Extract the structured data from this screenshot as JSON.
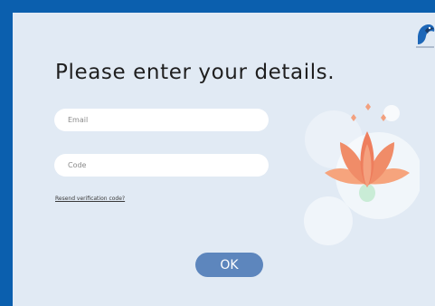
{
  "form": {
    "title": "Please enter your details.",
    "email_placeholder": "Email",
    "code_placeholder": "Code",
    "resend_link": "Resend verification code?",
    "ok_label": "OK"
  },
  "icons": {
    "logo": "bird-logo-icon",
    "decoration": "lotus-flower-icon"
  },
  "colors": {
    "frame": "#0b5fae",
    "panel": "#e1eaf4",
    "button": "#5d86bd",
    "lotus": "#f08c68"
  }
}
